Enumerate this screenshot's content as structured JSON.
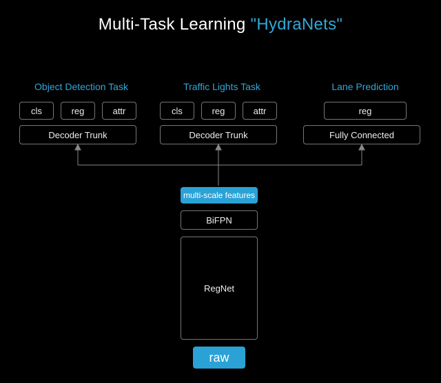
{
  "title": {
    "prefix": "Multi-Task Learning ",
    "accent": "\"HydraNets\""
  },
  "tasks": [
    {
      "name": "Object Detection Task",
      "heads": [
        "cls",
        "reg",
        "attr"
      ],
      "decoder": "Decoder Trunk"
    },
    {
      "name": "Traffic Lights Task",
      "heads": [
        "cls",
        "reg",
        "attr"
      ],
      "decoder": "Decoder Trunk"
    },
    {
      "name": "Lane Prediction",
      "heads": [
        "reg"
      ],
      "decoder": "Fully Connected"
    }
  ],
  "backbone": {
    "features": "multi-scale features",
    "bifpn": "BiFPN",
    "regnet": "RegNet",
    "raw": "raw"
  }
}
